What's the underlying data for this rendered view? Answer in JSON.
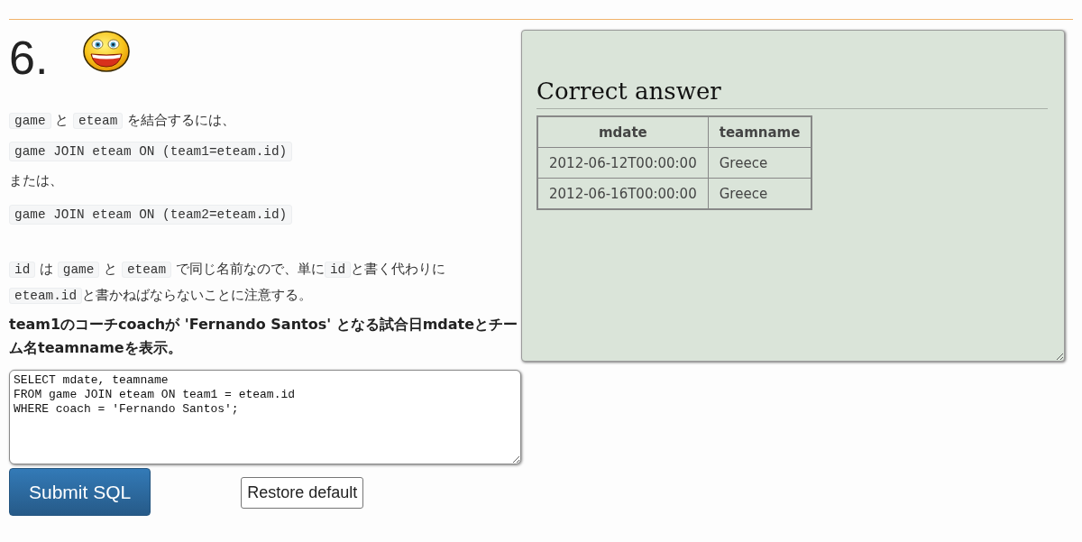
{
  "question": {
    "number": "6."
  },
  "explanation": [
    {
      "kind": "sentence",
      "parts": [
        {
          "kind": "code",
          "text": "game"
        },
        {
          "kind": "text",
          "text": " と "
        },
        {
          "kind": "code",
          "text": "eteam"
        },
        {
          "kind": "text",
          "text": " を結合するには、"
        }
      ]
    },
    {
      "kind": "code",
      "text": "game JOIN eteam ON (team1=eteam.id)"
    },
    {
      "kind": "sentence",
      "parts": [
        {
          "kind": "text",
          "text": "または、"
        }
      ]
    },
    {
      "kind": "code",
      "text": "game JOIN eteam ON (team2=eteam.id)"
    },
    {
      "kind": "note",
      "parts": [
        {
          "kind": "code",
          "text": "id"
        },
        {
          "kind": "text",
          "text": " は "
        },
        {
          "kind": "code",
          "text": "game"
        },
        {
          "kind": "text",
          "text": " と "
        },
        {
          "kind": "code",
          "text": "eteam"
        },
        {
          "kind": "text",
          "text": " で同じ名前なので、単に"
        },
        {
          "kind": "code",
          "text": "id"
        },
        {
          "kind": "text",
          "text": "と書く代わりに"
        },
        {
          "kind": "code",
          "text": "eteam.id"
        },
        {
          "kind": "text",
          "text": "と書かねばならないことに注意する。"
        }
      ]
    }
  ],
  "task": "team1のコーチcoachが 'Fernando Santos' となる試合日mdateとチーム名teamnameを表示。",
  "sql_editor": {
    "value": "SELECT mdate, teamname\nFROM game JOIN eteam ON team1 = eteam.id\nWHERE coach = 'Fernando Santos';"
  },
  "buttons": [
    {
      "kind": "primary",
      "label": "Submit SQL"
    },
    {
      "kind": "secondary",
      "label": "Restore default"
    }
  ],
  "answer_panel": {
    "title": "Correct answer",
    "table": {
      "columns": [
        "mdate",
        "teamname"
      ],
      "rows": [
        [
          "2012-06-12T00:00:00",
          "Greece"
        ],
        [
          "2012-06-16T00:00:00",
          "Greece"
        ]
      ]
    }
  }
}
